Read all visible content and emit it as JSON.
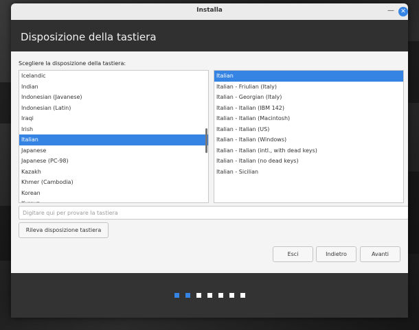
{
  "window": {
    "title": "Installa"
  },
  "header": {
    "page_title": "Disposizione della tastiera"
  },
  "main": {
    "prompt": "Scegliere la disposizione della tastiera:",
    "layouts": [
      {
        "label": "Icelandic",
        "selected": false
      },
      {
        "label": "Indian",
        "selected": false
      },
      {
        "label": "Indonesian (Javanese)",
        "selected": false
      },
      {
        "label": "Indonesian (Latin)",
        "selected": false
      },
      {
        "label": "Iraqi",
        "selected": false
      },
      {
        "label": "Irish",
        "selected": false
      },
      {
        "label": "Italian",
        "selected": true
      },
      {
        "label": "Japanese",
        "selected": false
      },
      {
        "label": "Japanese (PC-98)",
        "selected": false
      },
      {
        "label": "Kazakh",
        "selected": false
      },
      {
        "label": "Khmer (Cambodia)",
        "selected": false
      },
      {
        "label": "Korean",
        "selected": false
      },
      {
        "label": "Kyrgyz",
        "selected": false
      }
    ],
    "variants": [
      {
        "label": "Italian",
        "selected": true
      },
      {
        "label": "Italian - Friulian (Italy)",
        "selected": false
      },
      {
        "label": "Italian - Georgian (Italy)",
        "selected": false
      },
      {
        "label": "Italian - Italian (IBM 142)",
        "selected": false
      },
      {
        "label": "Italian - Italian (Macintosh)",
        "selected": false
      },
      {
        "label": "Italian - Italian (US)",
        "selected": false
      },
      {
        "label": "Italian - Italian (Windows)",
        "selected": false
      },
      {
        "label": "Italian - Italian (intl., with dead keys)",
        "selected": false
      },
      {
        "label": "Italian - Italian (no dead keys)",
        "selected": false
      },
      {
        "label": "Italian - Sicilian",
        "selected": false
      }
    ],
    "test_input": {
      "value": "",
      "placeholder": "Digitare qui per provare la tastiera"
    },
    "detect_label": "Rileva disposizione tastiera"
  },
  "nav": {
    "quit_label": "Esci",
    "back_label": "Indietro",
    "next_label": "Avanti"
  },
  "progress": {
    "total_steps": 7,
    "current_step": 2
  },
  "colors": {
    "accent": "#3584e4",
    "header_bg": "#303030",
    "footer_bg": "#333333"
  },
  "icons": {
    "minimize": "minimize-icon",
    "close": "close-icon"
  }
}
